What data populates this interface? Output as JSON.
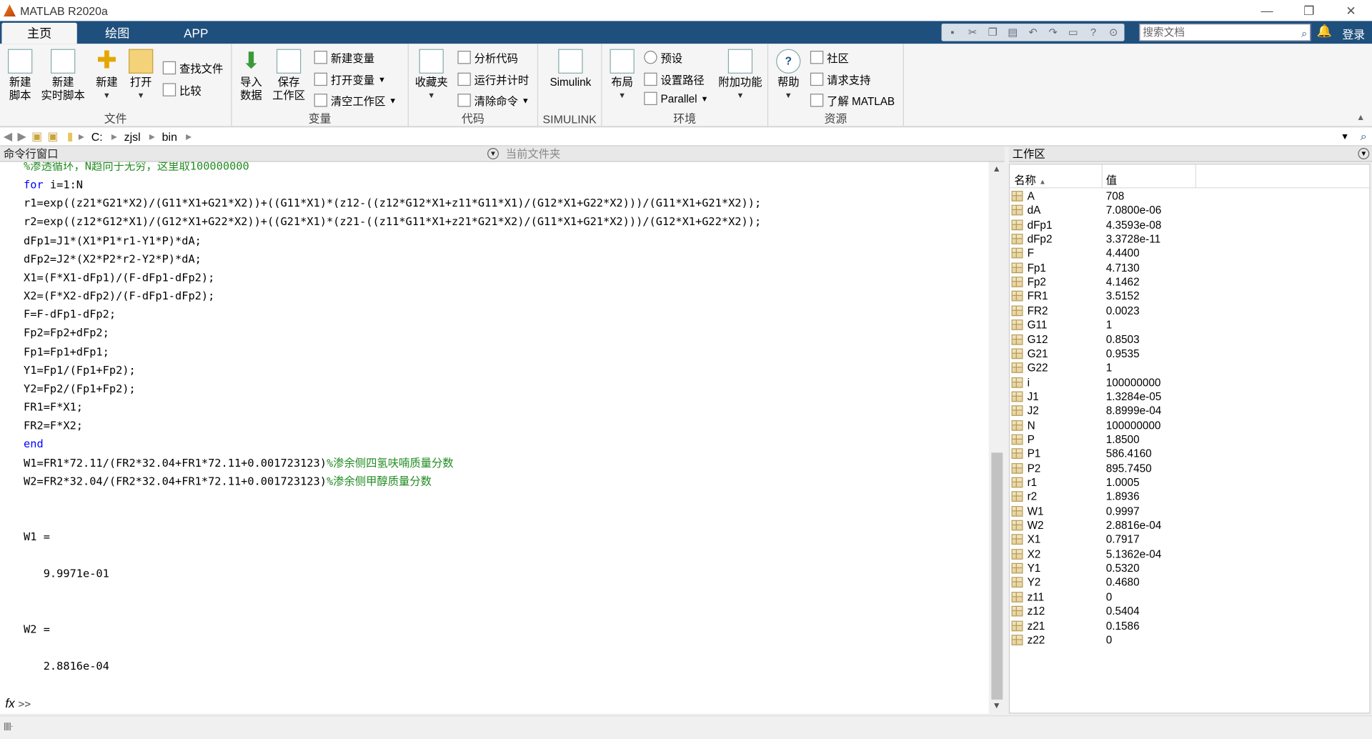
{
  "window": {
    "title": "MATLAB R2020a",
    "minimize": "—",
    "restore": "❐",
    "close": "✕"
  },
  "tabs": [
    {
      "label": "主页"
    },
    {
      "label": "绘图"
    },
    {
      "label": "APP"
    }
  ],
  "search": {
    "placeholder": "搜索文档"
  },
  "login_label": "登录",
  "ribbon": {
    "file": {
      "caption": "文件",
      "new_script": [
        "新建",
        "脚本"
      ],
      "new_live_script": [
        "新建",
        "实时脚本"
      ],
      "new": "新建",
      "open": "打开",
      "find_files": "查找文件",
      "compare": "比较"
    },
    "variable": {
      "caption": "变量",
      "import": [
        "导入",
        "数据"
      ],
      "save_ws": [
        "保存",
        "工作区"
      ],
      "new_var": "新建变量",
      "open_var": "打开变量",
      "clear_ws": "清空工作区"
    },
    "code": {
      "caption": "代码",
      "favorites": "收藏夹",
      "analyze": "分析代码",
      "run_time": "运行并计时",
      "clear_cmd": "清除命令"
    },
    "simulink": {
      "caption": "SIMULINK",
      "label": "Simulink"
    },
    "env": {
      "caption": "环境",
      "layout": "布局",
      "prefs": "预设",
      "set_path": "设置路径",
      "parallel": "Parallel",
      "addons": "附加功能"
    },
    "resources": {
      "caption": "资源",
      "help": "帮助",
      "community": "社区",
      "support": "请求支持",
      "learn": "了解 MATLAB"
    }
  },
  "address": {
    "segments": [
      "C:",
      "zjsl",
      "bin"
    ]
  },
  "panels": {
    "command_window": "命令行窗口",
    "current_folder": "当前文件夹",
    "workspace": "工作区"
  },
  "command_lines": [
    {
      "t": "%渗透循环，N趋向于无穷，这里取100000000",
      "c": "cm"
    },
    {
      "t": "for i=1:N",
      "c": "for"
    },
    {
      "t": "r1=exp((z21*G21*X2)/(G11*X1+G21*X2))+((G11*X1)*(z12-((z12*G12*X1+z11*G11*X1)/(G12*X1+G22*X2)))/(G11*X1+G21*X2));",
      "c": ""
    },
    {
      "t": "r2=exp((z12*G12*X1)/(G12*X1+G22*X2))+((G21*X1)*(z21-((z11*G11*X1+z21*G21*X2)/(G11*X1+G21*X2)))/(G12*X1+G22*X2));",
      "c": ""
    },
    {
      "t": "dFp1=J1*(X1*P1*r1-Y1*P)*dA;",
      "c": ""
    },
    {
      "t": "dFp2=J2*(X2*P2*r2-Y2*P)*dA;",
      "c": ""
    },
    {
      "t": "X1=(F*X1-dFp1)/(F-dFp1-dFp2);",
      "c": ""
    },
    {
      "t": "X2=(F*X2-dFp2)/(F-dFp1-dFp2);",
      "c": ""
    },
    {
      "t": "F=F-dFp1-dFp2;",
      "c": ""
    },
    {
      "t": "Fp2=Fp2+dFp2;",
      "c": ""
    },
    {
      "t": "Fp1=Fp1+dFp1;",
      "c": ""
    },
    {
      "t": "Y1=Fp1/(Fp1+Fp2);",
      "c": ""
    },
    {
      "t": "Y2=Fp2/(Fp1+Fp2);",
      "c": ""
    },
    {
      "t": "FR1=F*X1;",
      "c": ""
    },
    {
      "t": "FR2=F*X2;",
      "c": ""
    },
    {
      "t": "end",
      "c": "kw"
    },
    {
      "t": "W1=FR1*72.11/(FR2*32.04+FR1*72.11+0.001723123)",
      "cmt": "%渗余侧四氢呋喃质量分数",
      "c": "mix"
    },
    {
      "t": "W2=FR2*32.04/(FR2*32.04+FR1*72.11+0.001723123)",
      "cmt": "%渗余侧甲醇质量分数",
      "c": "mix"
    },
    {
      "t": "",
      "c": ""
    },
    {
      "t": "",
      "c": ""
    },
    {
      "t": "W1 =",
      "c": ""
    },
    {
      "t": "",
      "c": ""
    },
    {
      "t": "   9.9971e-01",
      "c": ""
    },
    {
      "t": "",
      "c": ""
    },
    {
      "t": "",
      "c": ""
    },
    {
      "t": "W2 =",
      "c": ""
    },
    {
      "t": "",
      "c": ""
    },
    {
      "t": "   2.8816e-04",
      "c": ""
    }
  ],
  "prompt": {
    "fx": "fx",
    "gt": ">>"
  },
  "workspace": {
    "col_name": "名称",
    "col_value": "值",
    "vars": [
      {
        "name": "A",
        "value": "708"
      },
      {
        "name": "dA",
        "value": "7.0800e-06"
      },
      {
        "name": "dFp1",
        "value": "4.3593e-08"
      },
      {
        "name": "dFp2",
        "value": "3.3728e-11"
      },
      {
        "name": "F",
        "value": "4.4400"
      },
      {
        "name": "Fp1",
        "value": "4.7130"
      },
      {
        "name": "Fp2",
        "value": "4.1462"
      },
      {
        "name": "FR1",
        "value": "3.5152"
      },
      {
        "name": "FR2",
        "value": "0.0023"
      },
      {
        "name": "G11",
        "value": "1"
      },
      {
        "name": "G12",
        "value": "0.8503"
      },
      {
        "name": "G21",
        "value": "0.9535"
      },
      {
        "name": "G22",
        "value": "1"
      },
      {
        "name": "i",
        "value": "100000000"
      },
      {
        "name": "J1",
        "value": "1.3284e-05"
      },
      {
        "name": "J2",
        "value": "8.8999e-04"
      },
      {
        "name": "N",
        "value": "100000000"
      },
      {
        "name": "P",
        "value": "1.8500"
      },
      {
        "name": "P1",
        "value": "586.4160"
      },
      {
        "name": "P2",
        "value": "895.7450"
      },
      {
        "name": "r1",
        "value": "1.0005"
      },
      {
        "name": "r2",
        "value": "1.8936"
      },
      {
        "name": "W1",
        "value": "0.9997"
      },
      {
        "name": "W2",
        "value": "2.8816e-04"
      },
      {
        "name": "X1",
        "value": "0.7917"
      },
      {
        "name": "X2",
        "value": "5.1362e-04"
      },
      {
        "name": "Y1",
        "value": "0.5320"
      },
      {
        "name": "Y2",
        "value": "0.4680"
      },
      {
        "name": "z11",
        "value": "0"
      },
      {
        "name": "z12",
        "value": "0.5404"
      },
      {
        "name": "z21",
        "value": "0.1586"
      },
      {
        "name": "z22",
        "value": "0"
      }
    ]
  }
}
